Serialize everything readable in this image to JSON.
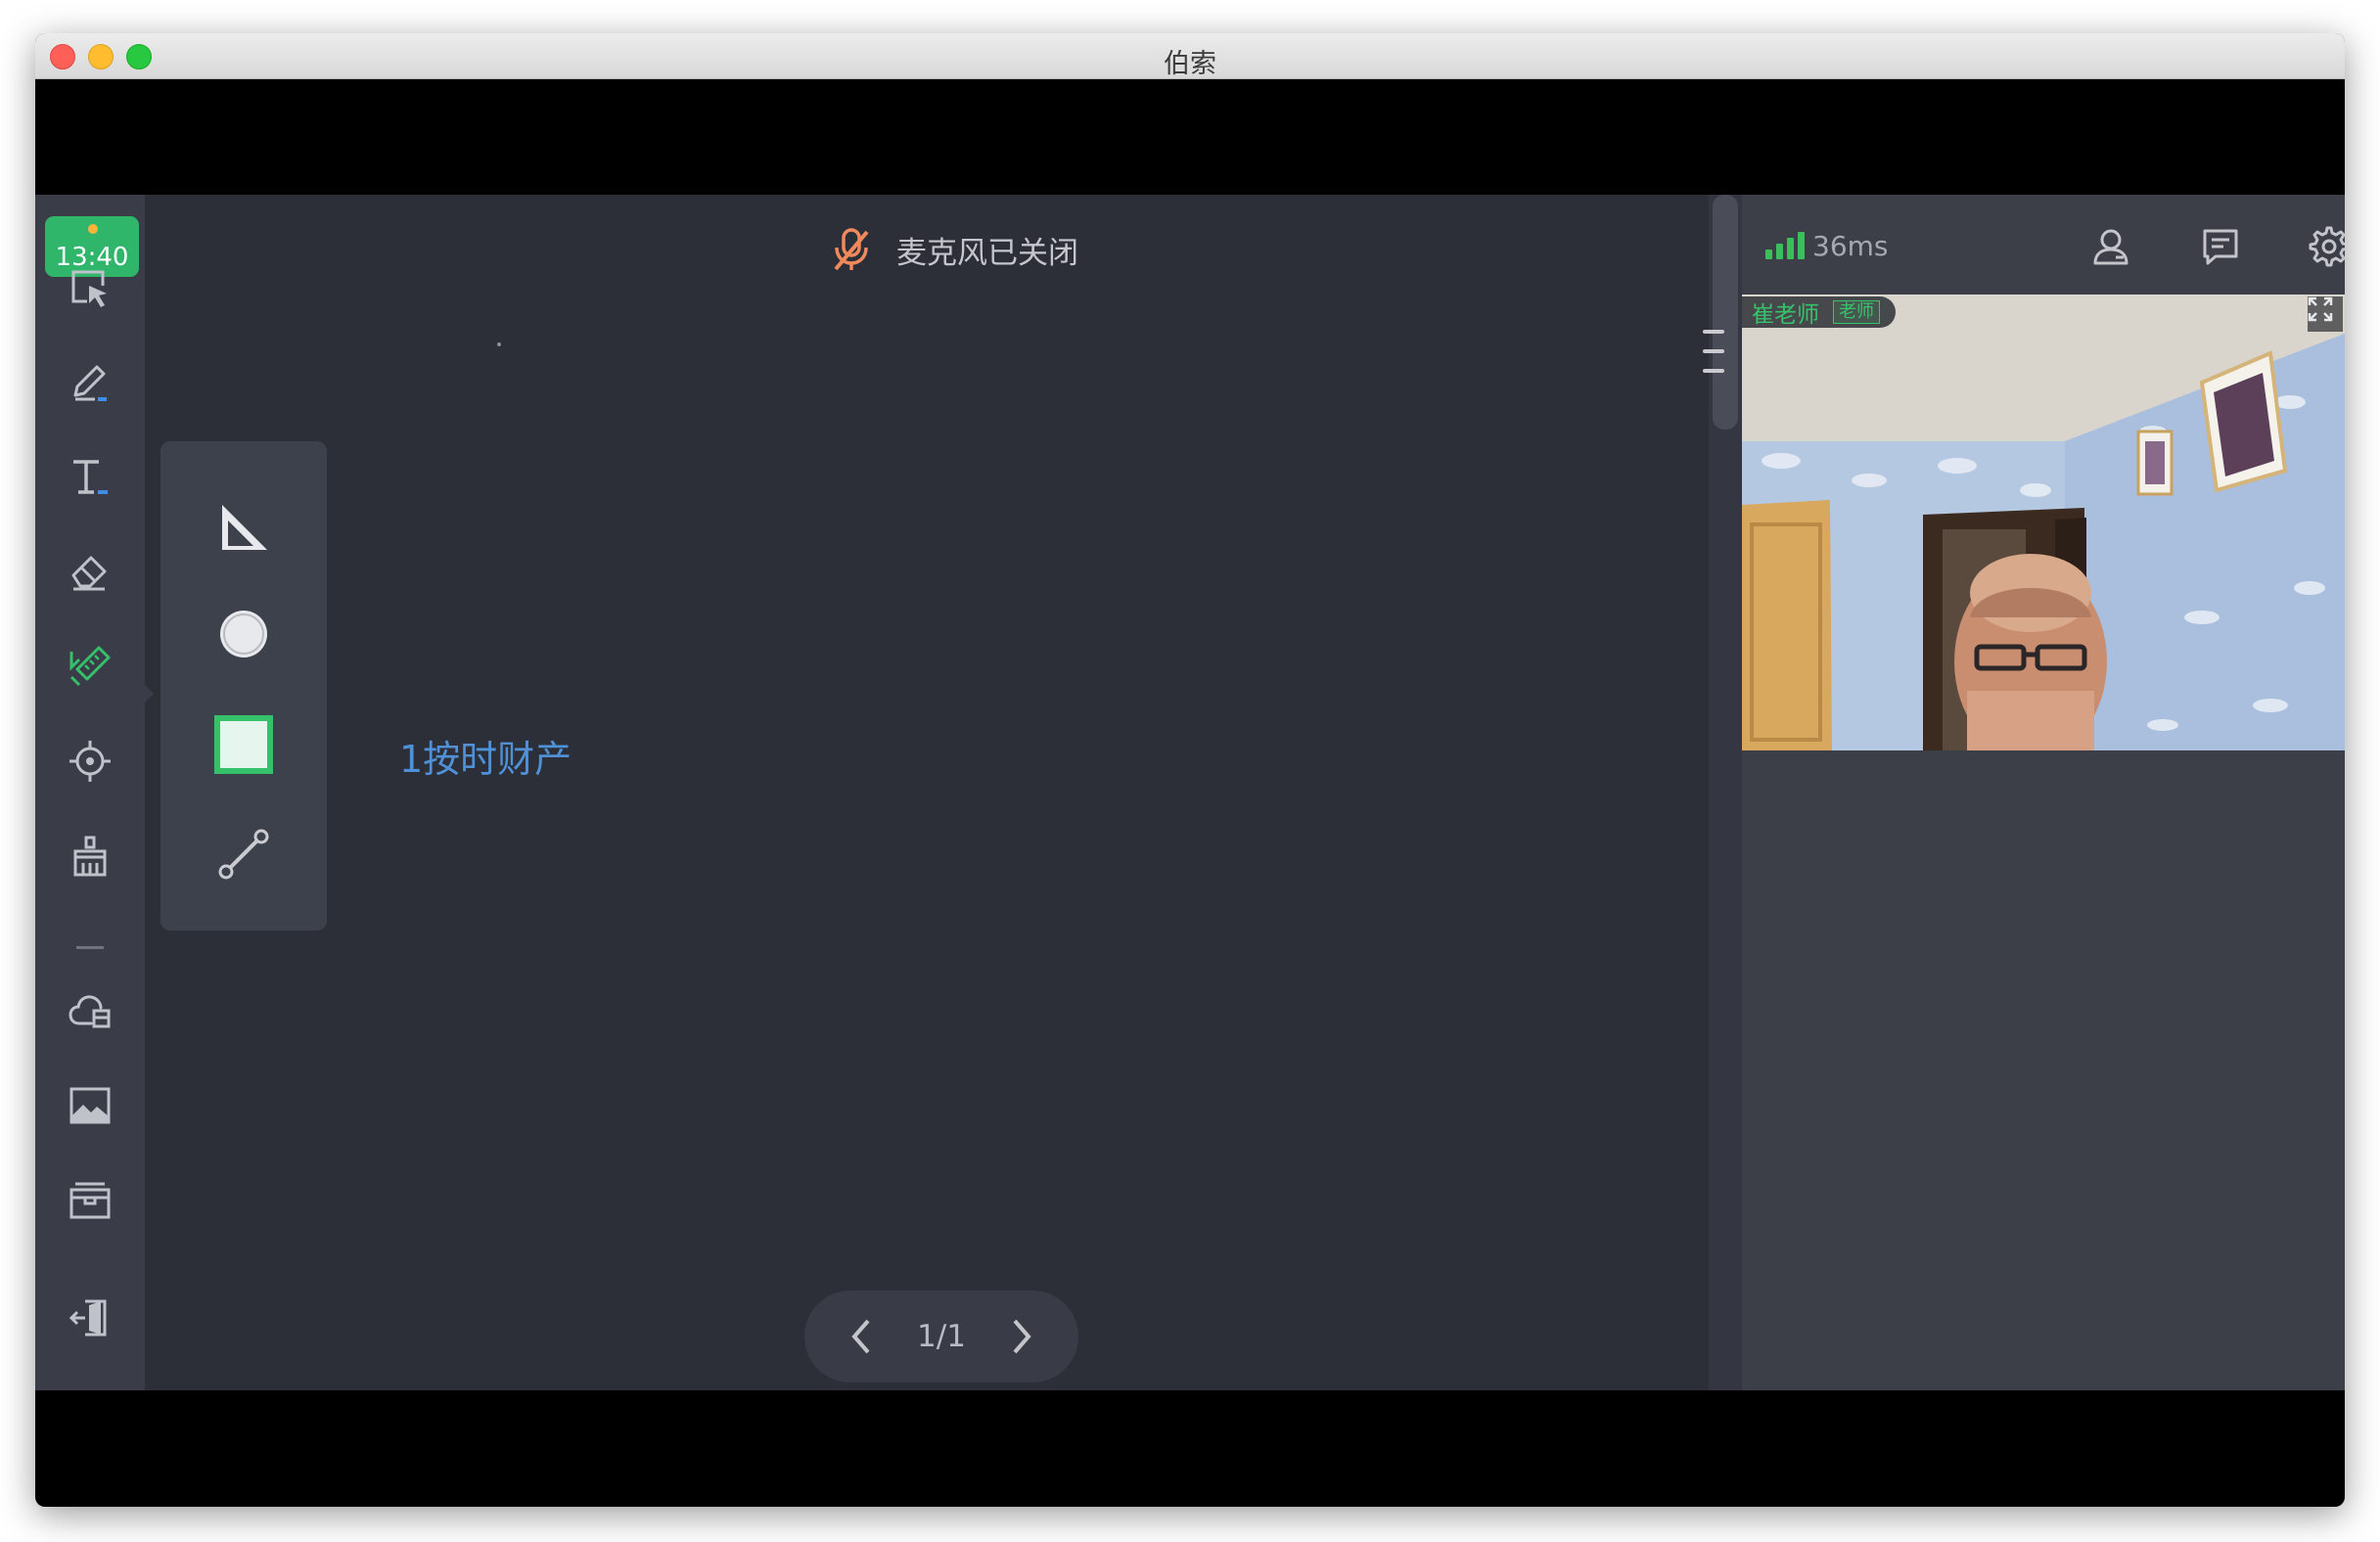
{
  "window": {
    "title": "伯索"
  },
  "sidebar": {
    "timer": "13:40",
    "tools": [
      "select-tool",
      "pen-tool",
      "text-tool",
      "eraser-tool",
      "shape-tool",
      "laser-pointer-tool",
      "clear-tool",
      "cloud-files-tool",
      "image-tool",
      "courseware-tool",
      "exit-tool"
    ]
  },
  "canvas": {
    "mic_status": "麦克风已关闭",
    "text": "1按时财产"
  },
  "shape_panel": {
    "shapes": [
      "triangle",
      "circle",
      "rectangle",
      "line"
    ],
    "active": "rectangle"
  },
  "pager": {
    "label": "1/1"
  },
  "right_panel": {
    "latency": "36ms",
    "teacher_name": "崔老师",
    "teacher_role": "老师"
  },
  "colors": {
    "accent": "#2fb66b",
    "mic_off": "#f08a5d",
    "canvas_text": "#4f90d6"
  }
}
